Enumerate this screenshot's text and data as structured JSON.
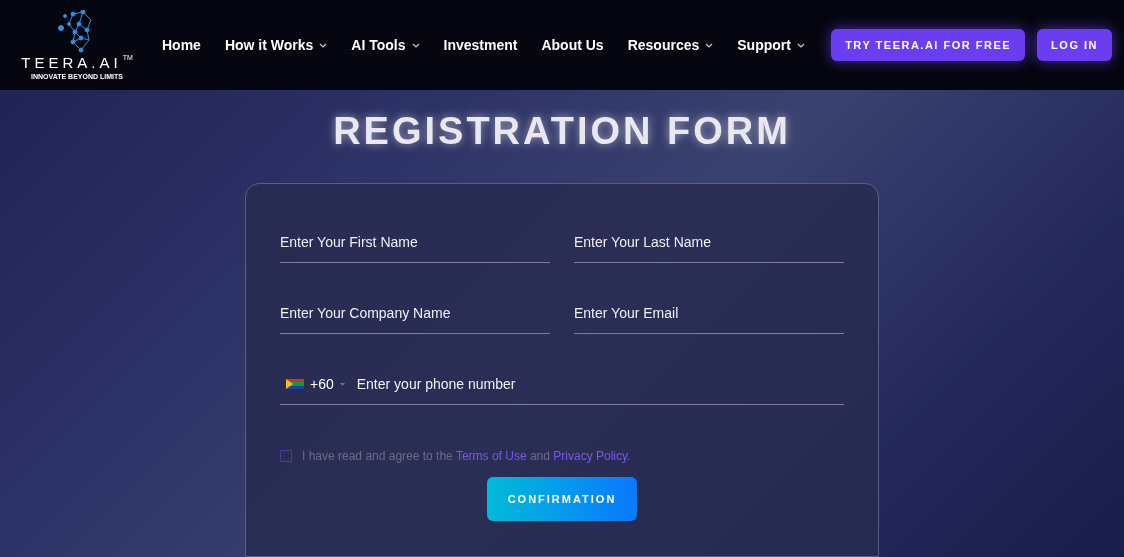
{
  "header": {
    "logo": {
      "name": "TEERA.AI",
      "mark": "TM",
      "tagline": "INNOVATE BEYOND LIMITS"
    },
    "nav": [
      {
        "label": "Home",
        "dropdown": false
      },
      {
        "label": "How it Works",
        "dropdown": true
      },
      {
        "label": "AI Tools",
        "dropdown": true
      },
      {
        "label": "Investment",
        "dropdown": false
      },
      {
        "label": "About Us",
        "dropdown": false
      },
      {
        "label": "Resources",
        "dropdown": true
      },
      {
        "label": "Support",
        "dropdown": true
      }
    ],
    "buttons": [
      "TRY TEERA.AI FOR FREE",
      "LOG IN"
    ]
  },
  "title": "REGISTRATION FORM",
  "form": {
    "fields": [
      {
        "placeholder": "Enter Your First Name"
      },
      {
        "placeholder": "Enter Your Last Name"
      },
      {
        "placeholder": "Enter Your Company Name"
      },
      {
        "placeholder": "Enter Your Email"
      }
    ],
    "phone": {
      "code": "+60",
      "placeholder": "Enter your phone number"
    },
    "agreement": {
      "checked": false,
      "text_before": "I have read and agree to the",
      "link_1": "Terms of Use",
      "text_middle": "and",
      "link_2": "Privacy Policy",
      "text_after": "."
    },
    "submit": "CONFIRMATION"
  }
}
